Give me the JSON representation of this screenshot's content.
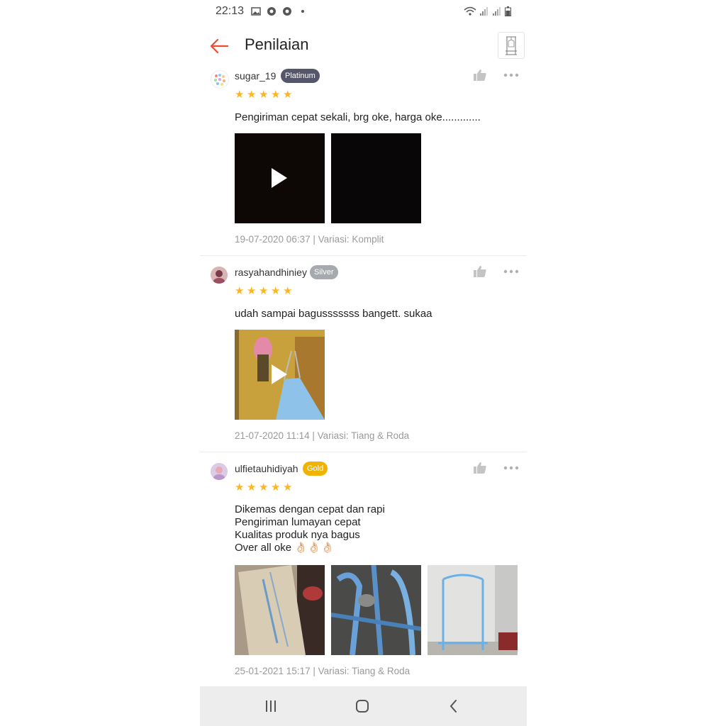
{
  "status_bar": {
    "time": "22:13"
  },
  "header": {
    "title": "Penilaian"
  },
  "reviews": [
    {
      "username": "sugar_19",
      "badge": "Platinum",
      "rating": 5,
      "comment": "Pengiriman cepat sekali, brg oke, harga oke.............",
      "meta": "19-07-2020 06:37 | Variasi: Komplit"
    },
    {
      "username": "rasyahandhiniey",
      "badge": "Silver",
      "rating": 5,
      "comment": "udah sampai bagusssssss bangett. sukaa",
      "meta": "21-07-2020 11:14 | Variasi: Tiang & Roda"
    },
    {
      "username": "ulfietauhidiyah",
      "badge": "Gold",
      "rating": 5,
      "comment_lines": [
        "Dikemas dengan cepat dan rapi",
        "Pengiriman lumayan cepat",
        "Kualitas produk nya bagus",
        "Over all oke 👌🏻👌🏻👌🏻"
      ],
      "meta": "25-01-2021 15:17 | Variasi: Tiang & Roda"
    }
  ],
  "colors": {
    "accent": "#ee4d2d",
    "star": "#ffb61e",
    "platinum": "#55566b",
    "silver": "#a6a9ad",
    "gold": "#f0b400"
  },
  "icons": [
    "back-arrow-icon",
    "thumbs-up-icon",
    "more-icon",
    "play-icon",
    "recents-icon",
    "home-icon",
    "back-icon"
  ]
}
